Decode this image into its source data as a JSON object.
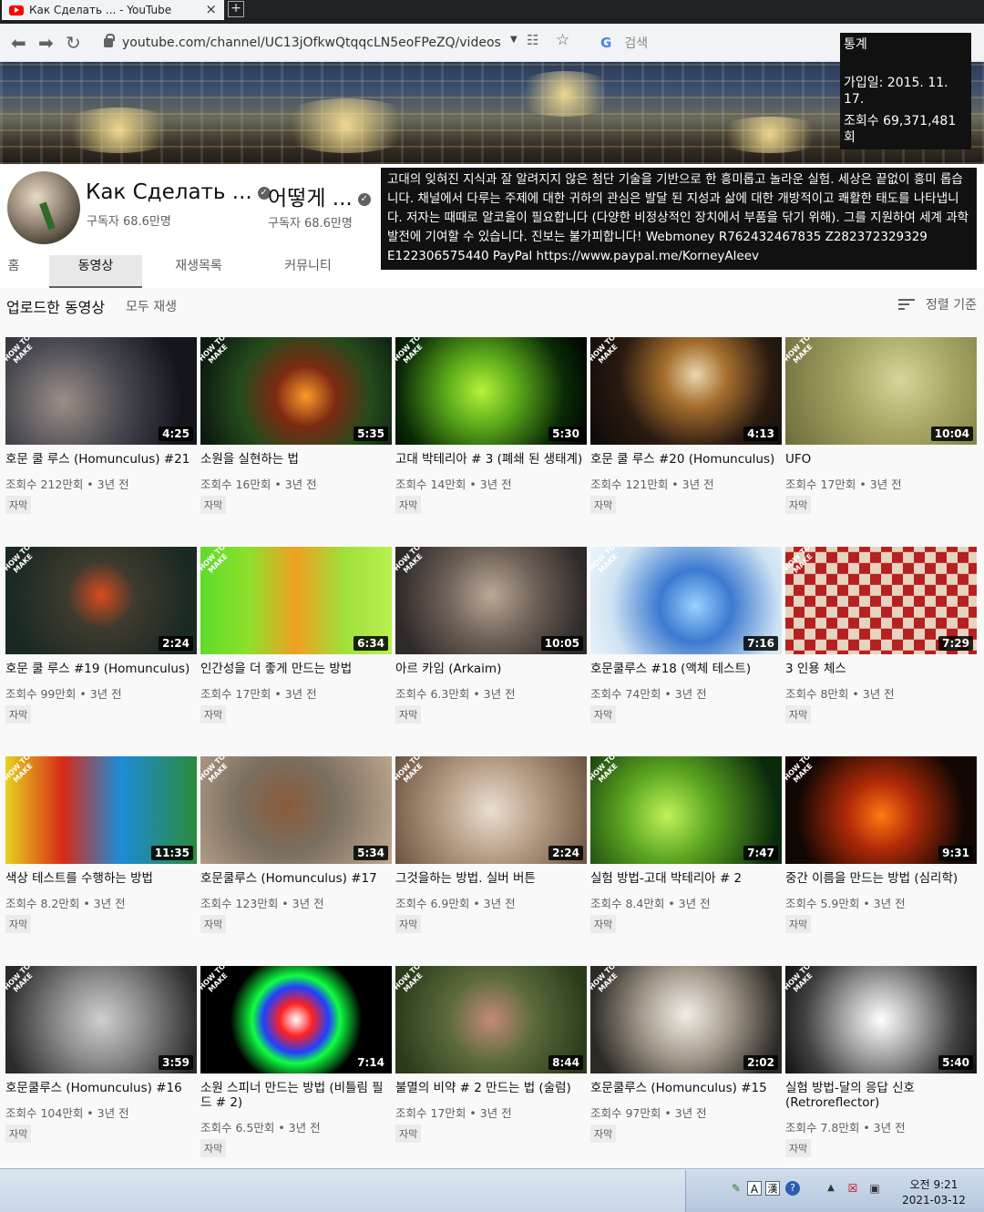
{
  "browser": {
    "tab_title": "Как Сделать ... - YouTube",
    "tab_close": "×",
    "new_tab": "+",
    "url": "youtube.com/channel/UC13jOfkwQtqqcLN5eoFPeZQ/videos",
    "search_placeholder": "검색",
    "search_engine": "G"
  },
  "stats": {
    "title": "통계",
    "joined": "가입일: 2015. 11. 17.",
    "views": "조회수 69,371,481회"
  },
  "channel": {
    "name1": "Как Сделать ...",
    "subs1": "구독자 68.6만명",
    "name2": "어떻게 ...",
    "subs2": "구독자 68.6만명",
    "description": "고대의 잊혀진 지식과 잘 알려지지 않은 첨단 기술을 기반으로 한 흥미롭고 놀라운 실험. 세상은 끝없이 흥미 롭습니다. 채널에서 다루는 주제에 대한 귀하의 관심은 발달 된 지성과 삶에 대한 개방적이고 쾌활한 태도를 나타냅니다. 저자는 때때로 알코올이 필요합니다 (다양한 비정상적인 장치에서 부품을 닦기 위해). 그를 지원하여 세계 과학 발전에 기여할 수 있습니다. 진보는 불가피합니다! Webmoney R762432467835 Z282372329329 E122306575440 PayPal https://www.paypal.me/KorneyAleev",
    "verified": "✓"
  },
  "tabs": [
    {
      "label": "홈"
    },
    {
      "label": "동영상"
    },
    {
      "label": "재생목록"
    },
    {
      "label": "커뮤니티"
    }
  ],
  "section": {
    "title": "업로드한 동영상",
    "play_all": "모두 재생",
    "sort": "정렬 기준"
  },
  "badge": "HOW TO MAKE",
  "videos": [
    {
      "title": "호문 쿨 루스 (Homunculus) #21",
      "meta": "조회수 212만회 • 3년 전",
      "duration": "4:25",
      "cc": "자막"
    },
    {
      "title": "소원을 실현하는 법",
      "meta": "조회수 16만회 • 3년 전",
      "duration": "5:35",
      "cc": "자막"
    },
    {
      "title": "고대 박테리아 # 3 (폐쇄 된 생태계)",
      "meta": "조회수 14만회 • 3년 전",
      "duration": "5:30",
      "cc": "자막"
    },
    {
      "title": "호문 쿨 루스 #20 (Homunculus)",
      "meta": "조회수 121만회 • 3년 전",
      "duration": "4:13",
      "cc": "자막"
    },
    {
      "title": "UFO",
      "meta": "조회수 17만회 • 3년 전",
      "duration": "10:04",
      "cc": "자막"
    },
    {
      "title": "호문 쿨 루스 #19 (Homunculus)",
      "meta": "조회수 99만회 • 3년 전",
      "duration": "2:24",
      "cc": "자막"
    },
    {
      "title": "인간성을 더 좋게 만드는 방법",
      "meta": "조회수 17만회 • 3년 전",
      "duration": "6:34",
      "cc": "자막"
    },
    {
      "title": "아르 카임 (Arkaim)",
      "meta": "조회수 6.3만회 • 3년 전",
      "duration": "10:05",
      "cc": "자막"
    },
    {
      "title": "호문쿨루스 #18 (액체 테스트)",
      "meta": "조회수 74만회 • 3년 전",
      "duration": "7:16",
      "cc": "자막"
    },
    {
      "title": "3 인용 체스",
      "meta": "조회수 8만회 • 3년 전",
      "duration": "7:29",
      "cc": "자막"
    },
    {
      "title": "색상 테스트를 수행하는 방법",
      "meta": "조회수 8.2만회 • 3년 전",
      "duration": "11:35",
      "cc": "자막"
    },
    {
      "title": "호문쿨루스 (Homunculus) #17",
      "meta": "조회수 123만회 • 3년 전",
      "duration": "5:34",
      "cc": "자막"
    },
    {
      "title": "그것을하는 방법. 실버 버튼",
      "meta": "조회수 6.9만회 • 3년 전",
      "duration": "2:24",
      "cc": "자막"
    },
    {
      "title": "실험 방법-고대 박테리아 # 2",
      "meta": "조회수 8.4만회 • 3년 전",
      "duration": "7:47",
      "cc": "자막"
    },
    {
      "title": "중간 이름을 만드는 방법 (심리학)",
      "meta": "조회수 5.9만회 • 3년 전",
      "duration": "9:31",
      "cc": "자막"
    },
    {
      "title": "호문쿨루스 (Homunculus) #16",
      "meta": "조회수 104만회 • 3년 전",
      "duration": "3:59",
      "cc": "자막"
    },
    {
      "title": "소원 스피너 만드는 방법 (비틀림 필드 # 2)",
      "meta": "조회수 6.5만회 • 3년 전",
      "duration": "7:14",
      "cc": "자막"
    },
    {
      "title": "불멸의 비약 # 2 만드는 법 (술럼)",
      "meta": "조회수 17만회 • 3년 전",
      "duration": "8:44",
      "cc": "자막"
    },
    {
      "title": "호문쿨루스 (Homunculus) #15",
      "meta": "조회수 97만회 • 3년 전",
      "duration": "2:02",
      "cc": "자막"
    },
    {
      "title": "실험 방법-달의 응답 신호 (Retroreflector)",
      "meta": "조회수 7.8만회 • 3년 전",
      "duration": "5:40",
      "cc": "자막"
    }
  ],
  "taskbar": {
    "time": "오전 9:21",
    "date": "2021-03-12",
    "ime_a": "A",
    "ime_han": "漢"
  }
}
